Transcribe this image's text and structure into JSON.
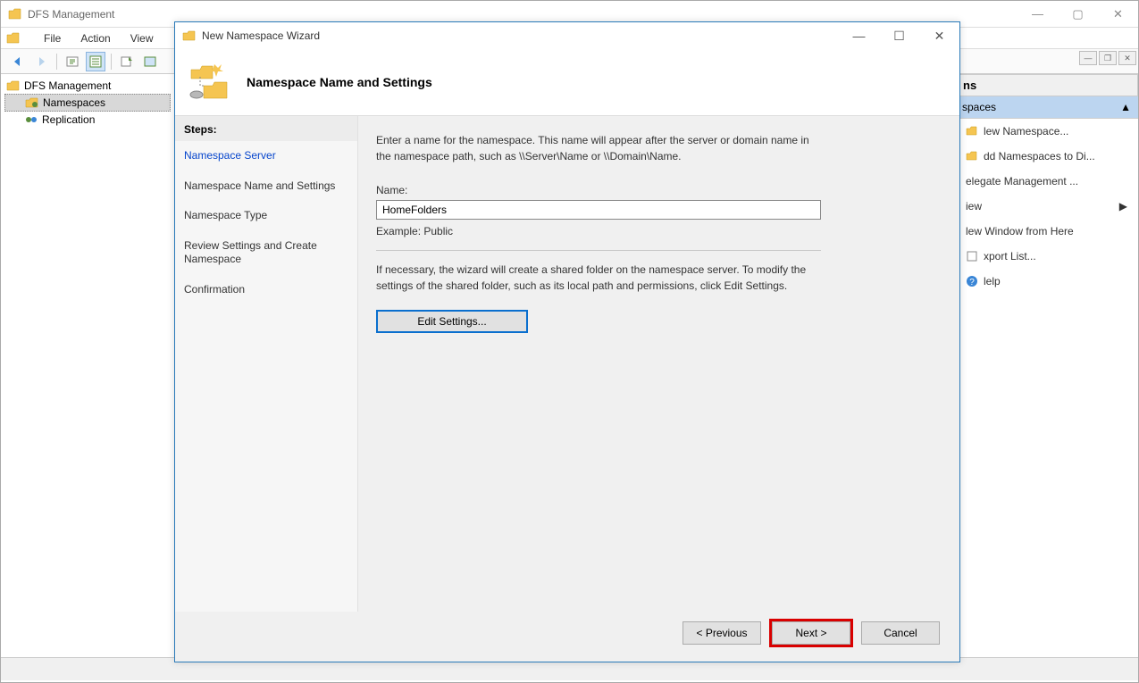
{
  "main_window": {
    "title": "DFS Management",
    "menu": {
      "file": "File",
      "action": "Action",
      "view": "View"
    },
    "tree": {
      "root": "DFS Management",
      "items": [
        {
          "label": "Namespaces",
          "selected": true
        },
        {
          "label": "Replication",
          "selected": false
        }
      ]
    },
    "actions": {
      "header": "ns",
      "subheader": "spaces",
      "items": [
        "lew Namespace...",
        "dd Namespaces to Di...",
        "elegate Management ...",
        "iew",
        "lew Window from Here",
        "xport List...",
        "lelp"
      ]
    }
  },
  "dialog": {
    "title": "New Namespace Wizard",
    "heading": "Namespace Name and Settings",
    "steps_header": "Steps:",
    "steps": [
      "Namespace Server",
      "Namespace Name and Settings",
      "Namespace Type",
      "Review Settings and Create Namespace",
      "Confirmation"
    ],
    "content": {
      "description": "Enter a name for the namespace. This name will appear after the server or domain name in the namespace path, such as \\\\Server\\Name or \\\\Domain\\Name.",
      "name_label": "Name:",
      "name_value": "HomeFolders",
      "example": "Example: Public",
      "description2": "If necessary, the wizard will create a shared folder on the namespace server. To modify the settings of the shared folder, such as its local path and permissions, click Edit Settings.",
      "edit_button": "Edit Settings..."
    },
    "footer": {
      "previous": "< Previous",
      "next": "Next >",
      "cancel": "Cancel"
    }
  }
}
